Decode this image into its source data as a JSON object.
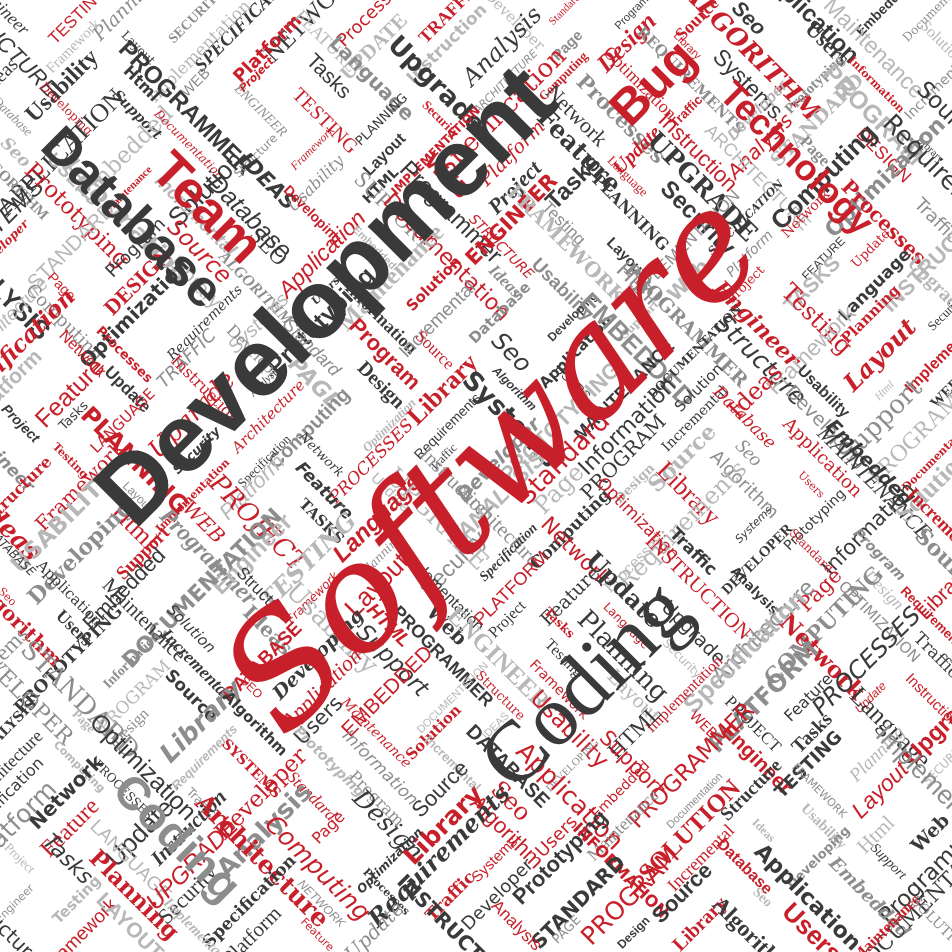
{
  "title": "Software Development",
  "colors": {
    "red": "#c8202a",
    "dark": "#3a3a3a",
    "gray": "#8d8d8d",
    "light": "#b7b7b7"
  },
  "highlights": {
    "software": "Software",
    "development": "Development",
    "coding_main": "Coding",
    "coding_small": "Coding",
    "database": "Database",
    "team_main": "Team",
    "bug_main": "Bug",
    "technology": "Technology"
  },
  "words": [
    "Engineer",
    "Testing",
    "Planning",
    "Security",
    "Specification",
    "Network",
    "Processes",
    "Traffic",
    "Developer",
    "Standard",
    "Program",
    "Source",
    "Seo",
    "Application",
    "Embedded",
    "Documentation",
    "Structure",
    "Framework",
    "Layout",
    "Implementation",
    "Platform",
    "Feature",
    "Update",
    "Instruction",
    "Analysis",
    "Page",
    "Design",
    "Library",
    "Algorithm",
    "Users",
    "Maintenance",
    "Solution",
    "Ideas",
    "Usability",
    "Html",
    "Web",
    "Project",
    "Tasks",
    "Language",
    "Upgrade",
    "Architecture",
    "Computing",
    "Optimization",
    "Requirements",
    "Systems",
    "Prototyping",
    "Information",
    "Incremental",
    "Database",
    "Developing",
    "Support",
    "Programmer"
  ]
}
